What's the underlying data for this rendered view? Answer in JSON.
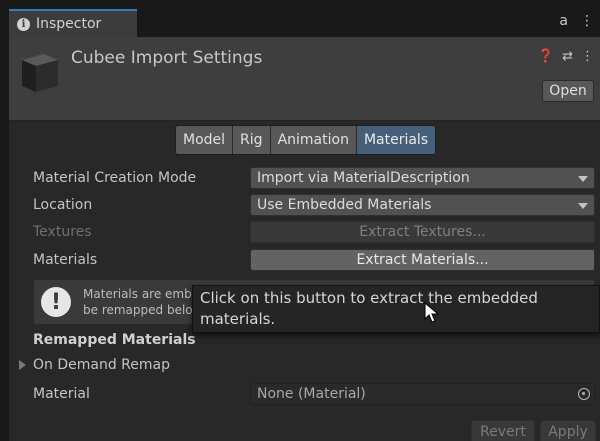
{
  "tab": {
    "label": "Inspector",
    "icon": "info-icon"
  },
  "tabbar_icons": {
    "lock": "a",
    "menu": "⋮"
  },
  "header": {
    "title": "Cubee Import Settings",
    "icons": {
      "help": "❓",
      "settings": "⇄",
      "menu": "⋮"
    },
    "open_label": "Open"
  },
  "tabs": [
    {
      "label": "Model",
      "active": false
    },
    {
      "label": "Rig",
      "active": false
    },
    {
      "label": "Animation",
      "active": false
    },
    {
      "label": "Materials",
      "active": true
    }
  ],
  "fields": {
    "material_creation_mode": {
      "label": "Material Creation Mode",
      "value": "Import via MaterialDescription"
    },
    "location": {
      "label": "Location",
      "value": "Use Embedded Materials"
    },
    "textures": {
      "label": "Textures",
      "button": "Extract Textures..."
    },
    "materials": {
      "label": "Materials",
      "button": "Extract Materials..."
    }
  },
  "helpbox": {
    "line1": "Materials are emb",
    "line2": "be remapped belo"
  },
  "tooltip": {
    "text": "Click on this button to extract the embedded materials."
  },
  "remapped": {
    "title": "Remapped Materials",
    "foldout": "On Demand Remap",
    "material_label": "Material",
    "material_value": "None (Material)"
  },
  "footer": {
    "revert": "Revert",
    "apply": "Apply"
  },
  "colors": {
    "active_tab": "#46607c",
    "accent": "#3a79bb"
  }
}
